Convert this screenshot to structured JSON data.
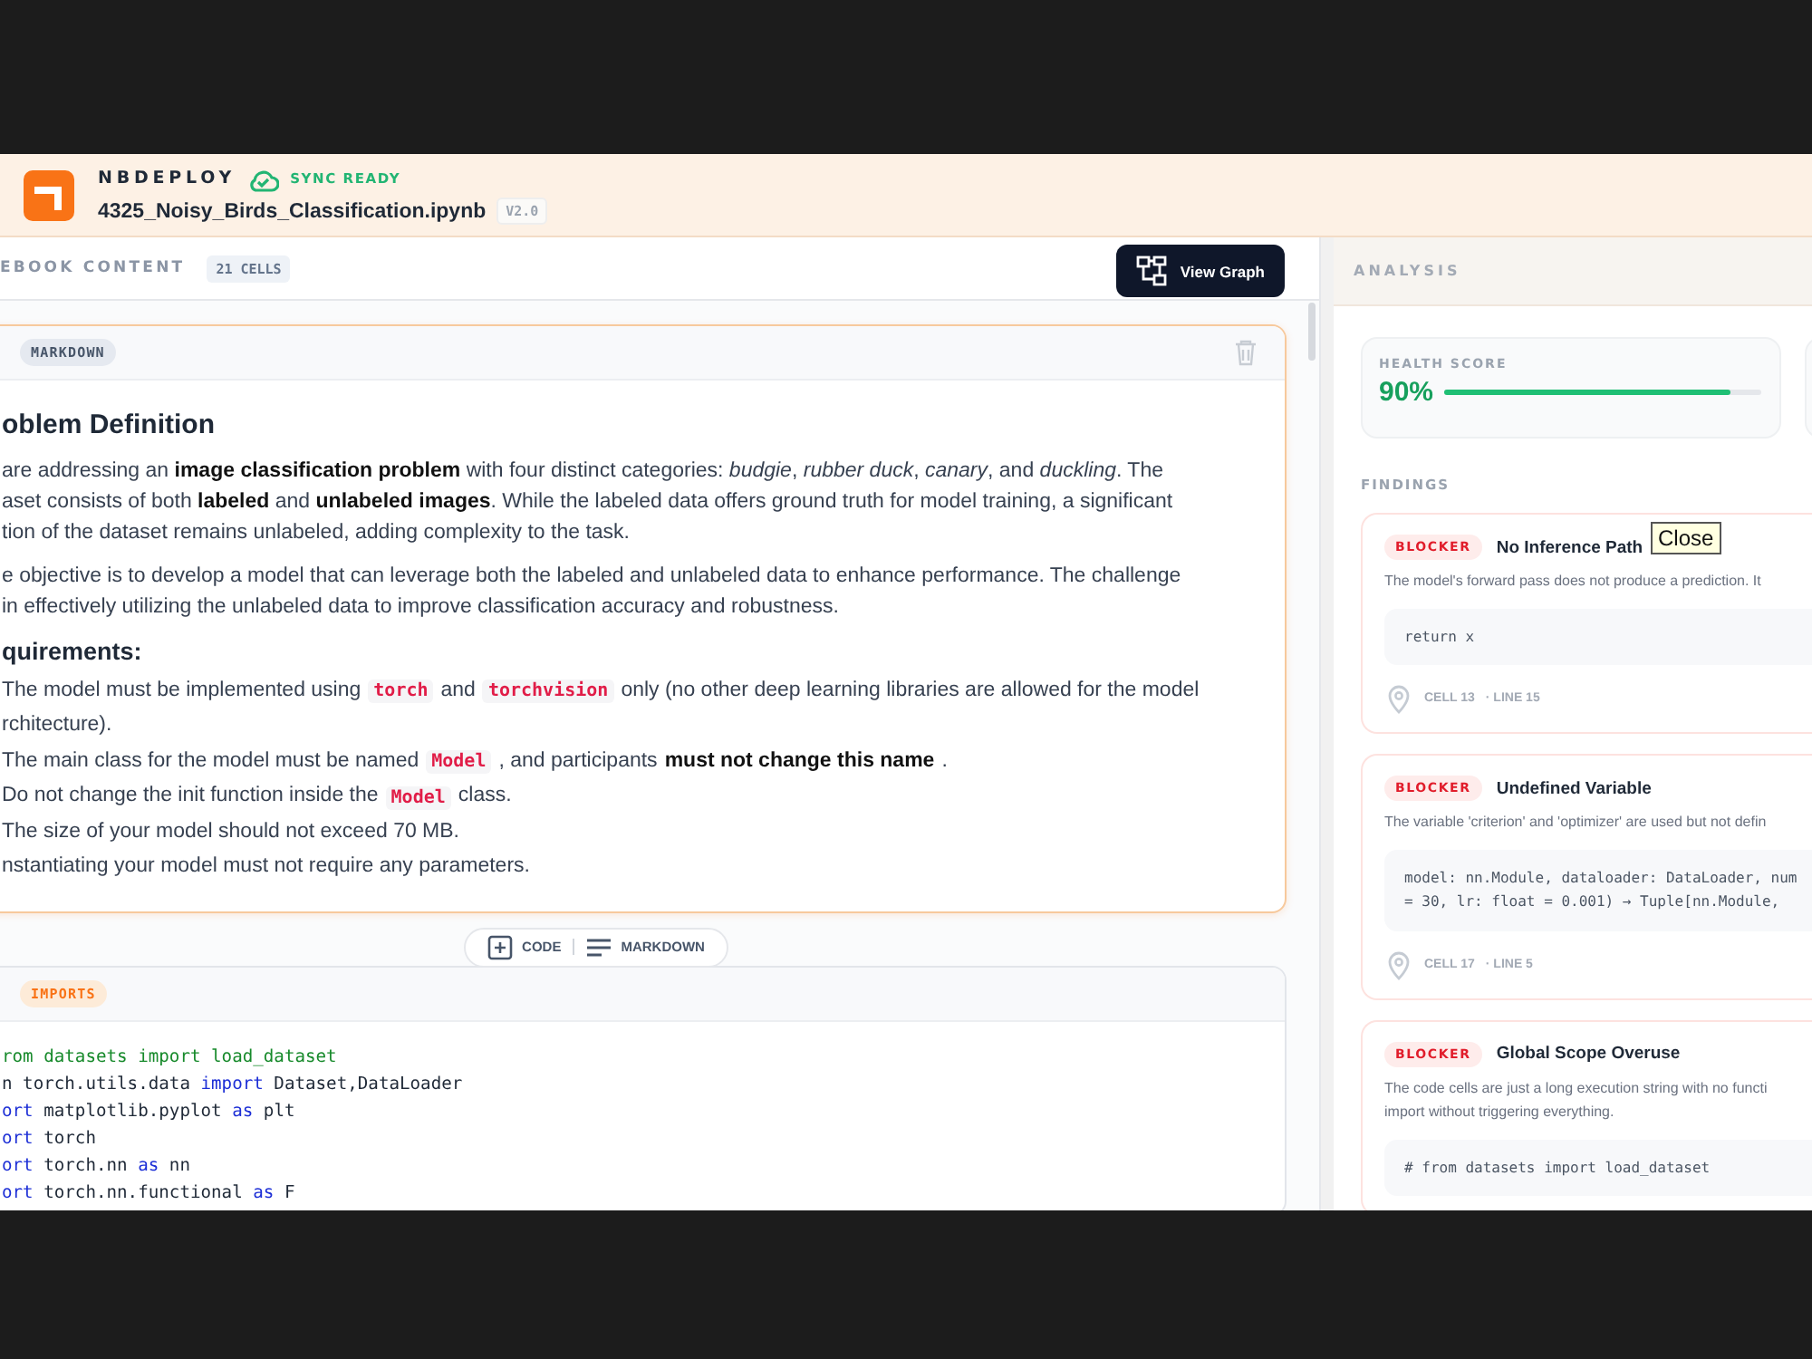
{
  "header": {
    "app_name": "NBDEPLOY",
    "sync_status": "SYNC READY",
    "filename": "4325_Noisy_Birds_Classification.ipynb",
    "version": "V2.0"
  },
  "notebook": {
    "title": "EBOOK CONTENT",
    "cell_count": "21 CELLS",
    "view_graph_button": "View Graph",
    "cells": [
      {
        "type_label": "MARKDOWN",
        "color": "#e5e9f0",
        "selected": true,
        "kind": "markdown",
        "heading": "oblem Definition",
        "paragraphs": [
          [
            "are addressing an **image classification problem** with four distinct categories: *budgie*, *rubber duck*, *canary*, and *duckling*. The",
            "aset consists of both **labeled** and **unlabeled images**. While the labeled data offers ground truth for model training, a significant",
            "tion of the dataset remains unlabeled, adding complexity to the task."
          ],
          [
            "e objective is to develop a model that can leverage both the labeled and unlabeled data to enhance performance. The challenge",
            "in effectively utilizing the unlabeled data to improve classification accuracy and robustness."
          ]
        ],
        "subheading": "quirements:",
        "list_lines": [
          [
            {
              "kind": "text",
              "text": "The model must be implemented using"
            },
            {
              "kind": "code",
              "text": "torch"
            },
            {
              "kind": "text",
              "text": "and"
            },
            {
              "kind": "code",
              "text": "torchvision"
            },
            {
              "kind": "text",
              "text": "only (no other deep learning libraries are allowed for the model"
            }
          ],
          [
            {
              "kind": "text",
              "text": "rchitecture)."
            }
          ],
          [
            {
              "kind": "text",
              "text": "The main class for the model must be named"
            },
            {
              "kind": "code",
              "text": "Model"
            },
            {
              "kind": "text",
              "text": ", and participants"
            },
            {
              "kind": "bold",
              "text": "must not change this name"
            },
            {
              "kind": "text",
              "text": "."
            }
          ],
          [
            {
              "kind": "text",
              "text": "Do not change the init function inside the"
            },
            {
              "kind": "code",
              "text": "Model"
            },
            {
              "kind": "text",
              "text": "class."
            }
          ],
          [
            {
              "kind": "text",
              "text": "The size of your model should not exceed 70 MB."
            }
          ],
          [
            {
              "kind": "text",
              "text": "nstantiating your model must not require any parameters."
            }
          ]
        ]
      },
      {
        "type_label": "IMPORTS",
        "color": "#fdebd8",
        "selected": false,
        "kind": "code",
        "code_lines": [
          [
            {
              "kind": "string",
              "text": "rom datasets import load_dataset"
            }
          ],
          [
            {
              "kind": "plain",
              "text": "n torch.utils.data "
            },
            {
              "kind": "keyword",
              "text": "import"
            },
            {
              "kind": "plain",
              "text": " Dataset,DataLoader"
            }
          ],
          [
            {
              "kind": "keyword",
              "text": "ort"
            },
            {
              "kind": "plain",
              "text": " matplotlib.pyplot "
            },
            {
              "kind": "keyword",
              "text": "as"
            },
            {
              "kind": "plain",
              "text": " plt"
            }
          ],
          [
            {
              "kind": "keyword",
              "text": "ort"
            },
            {
              "kind": "plain",
              "text": " torch"
            }
          ],
          [
            {
              "kind": "keyword",
              "text": "ort"
            },
            {
              "kind": "plain",
              "text": " torch.nn "
            },
            {
              "kind": "keyword",
              "text": "as"
            },
            {
              "kind": "plain",
              "text": " nn"
            }
          ],
          [
            {
              "kind": "keyword",
              "text": "ort"
            },
            {
              "kind": "plain",
              "text": " torch.nn.functional "
            },
            {
              "kind": "keyword",
              "text": "as"
            },
            {
              "kind": "plain",
              "text": " F"
            }
          ]
        ]
      }
    ],
    "add_bar": {
      "code_label": "CODE",
      "markdown_label": "MARKDOWN"
    }
  },
  "analysis": {
    "title": "ANALYSIS",
    "health": {
      "label": "HEALTH SCORE",
      "value": "90%",
      "level": 0.9
    },
    "findings_label": "FINDINGS",
    "findings": [
      {
        "severity": "BLOCKER",
        "title": "No Inference Path",
        "description": [
          "The model's forward pass does not produce a prediction. It"
        ],
        "code": [
          "return x"
        ],
        "cell": "CELL 13",
        "line": "· LINE 15"
      },
      {
        "severity": "BLOCKER",
        "title": "Undefined Variable",
        "description": [
          "The variable 'criterion' and 'optimizer' are used but not defin"
        ],
        "code": [
          "model: nn.Module, dataloader: DataLoader, num",
          "= 30, lr: float = 0.001) → Tuple[nn.Module,"
        ],
        "cell": "CELL 17",
        "line": "· LINE 5"
      },
      {
        "severity": "BLOCKER",
        "title": "Global Scope Overuse",
        "description": [
          "The code cells are just a long execution string with no functi",
          "import without triggering everything."
        ],
        "code": [
          "# from datasets import load_dataset"
        ]
      }
    ]
  },
  "tooltip": {
    "text": "Close"
  }
}
